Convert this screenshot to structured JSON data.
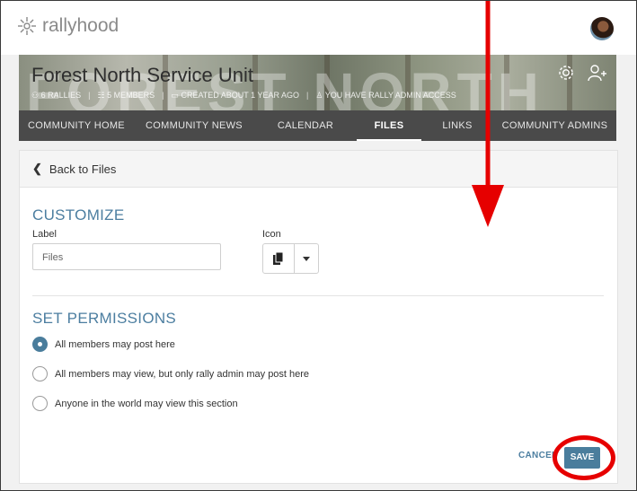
{
  "app": {
    "name": "rallyhood"
  },
  "hero": {
    "title": "Forest North Service Unit",
    "background_text": "FOREST NORTH",
    "meta": {
      "rallies": "6 RALLIES",
      "members": "5 MEMBERS",
      "created": "CREATED ABOUT 1 YEAR AGO",
      "admin": "YOU HAVE RALLY ADMIN ACCESS"
    }
  },
  "nav": {
    "tabs": [
      {
        "label": "COMMUNITY HOME",
        "active": false
      },
      {
        "label": "COMMUNITY NEWS",
        "active": false
      },
      {
        "label": "CALENDAR",
        "active": false
      },
      {
        "label": "FILES",
        "active": true
      },
      {
        "label": "LINKS",
        "active": false
      },
      {
        "label": "COMMUNITY ADMINS",
        "active": false
      }
    ]
  },
  "card": {
    "back_label": "Back to Files",
    "customize": {
      "title": "CUSTOMIZE",
      "label_caption": "Label",
      "label_value": "Files",
      "icon_caption": "Icon",
      "icon_name": "files-icon"
    },
    "permissions": {
      "title": "SET PERMISSIONS",
      "options": [
        {
          "label": "All members may post here",
          "selected": true
        },
        {
          "label": "All members may view, but only rally admin may post here",
          "selected": false
        },
        {
          "label": "Anyone in the world may view this section",
          "selected": false
        }
      ]
    },
    "actions": {
      "cancel": "CANCEL",
      "save": "SAVE"
    }
  },
  "colors": {
    "accent": "#4a7d9c",
    "nav_bg": "#4a4a4a",
    "annotation": "#e60000"
  }
}
